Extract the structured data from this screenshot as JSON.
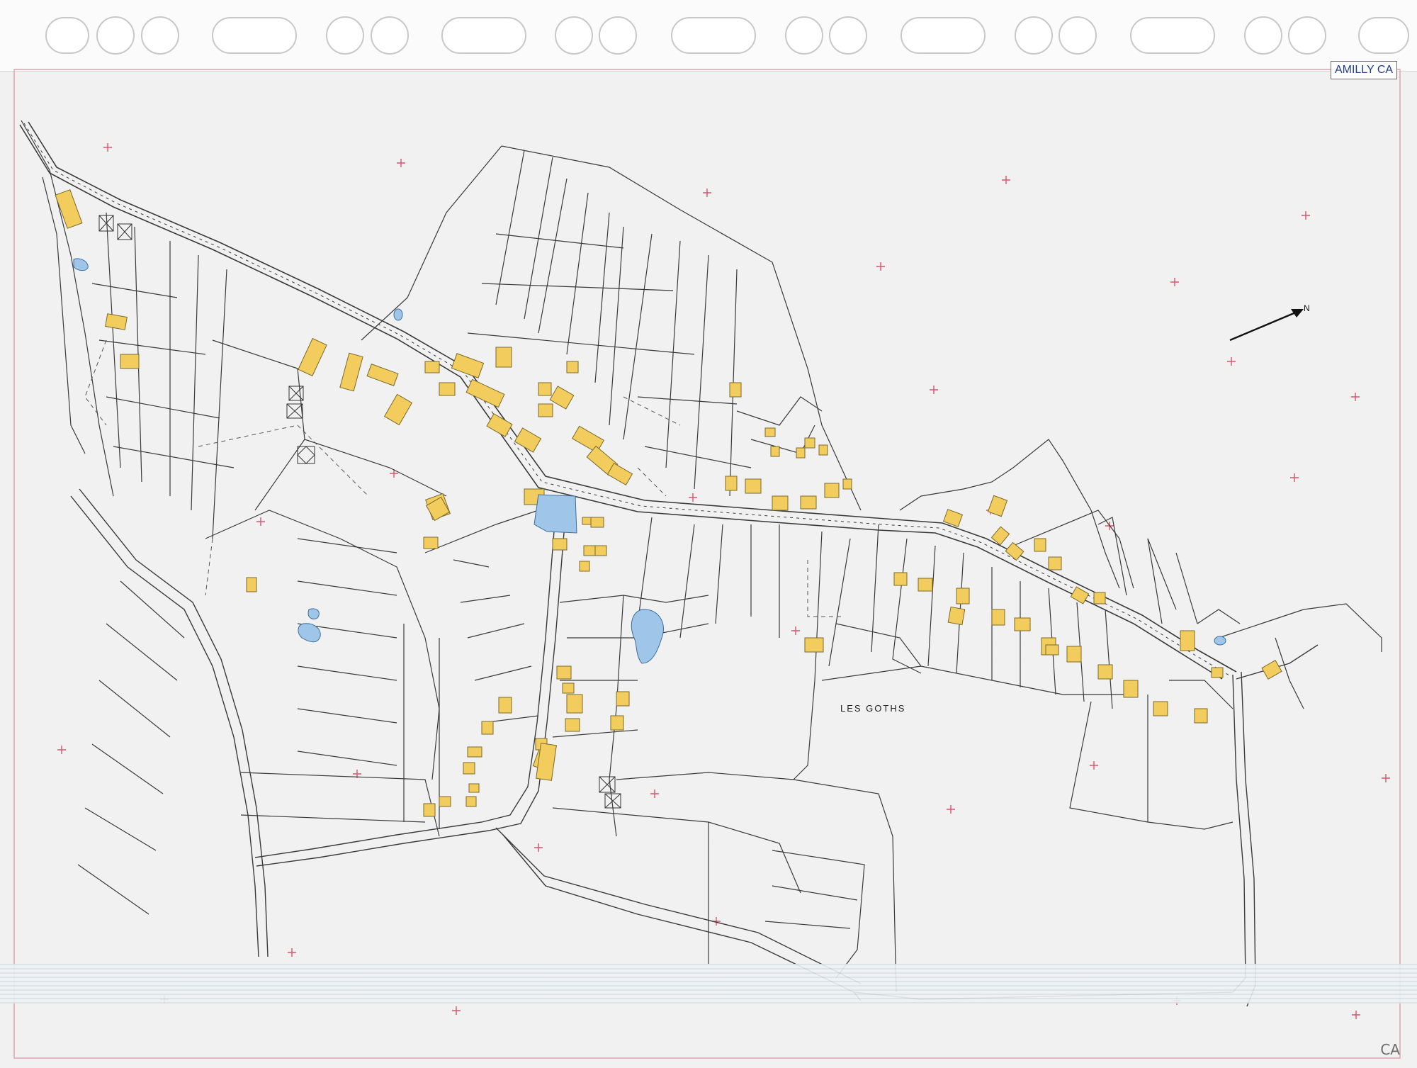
{
  "sheet": {
    "code": "AMILLY CA",
    "corner_mark": "CA"
  },
  "map": {
    "place_name": "LES GOTHS",
    "north_label": "N",
    "colors": {
      "background": "#f1f1f1",
      "parcel_line": "#3a3a3a",
      "building_fill": "#f2cd5d",
      "building_stroke": "#7a6a2a",
      "water_fill": "#9fc6e8",
      "grid_cross": "#d9536b"
    }
  }
}
